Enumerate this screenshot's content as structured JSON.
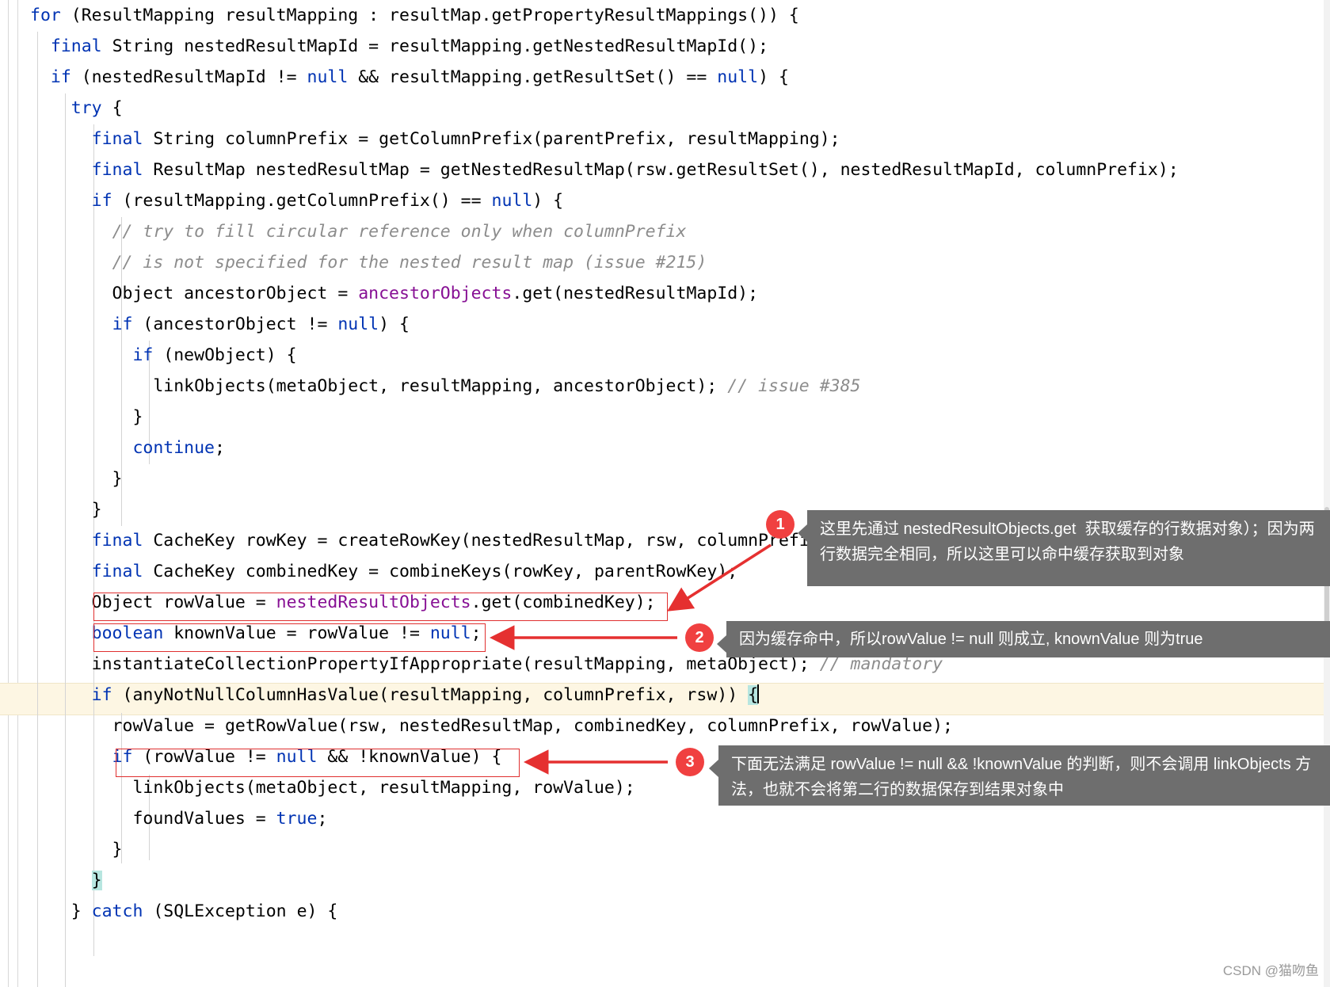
{
  "editor": {
    "language": "java",
    "lines": [
      [
        {
          "t": "kw",
          "s": "for"
        },
        {
          "t": "pln",
          "s": " (ResultMapping resultMapping : resultMap.getPropertyResultMappings()) {"
        }
      ],
      [
        {
          "t": "pln",
          "s": "  "
        },
        {
          "t": "kw",
          "s": "final"
        },
        {
          "t": "pln",
          "s": " String nestedResultMapId = resultMapping.getNestedResultMapId();"
        }
      ],
      [
        {
          "t": "pln",
          "s": "  "
        },
        {
          "t": "kw",
          "s": "if"
        },
        {
          "t": "pln",
          "s": " (nestedResultMapId != "
        },
        {
          "t": "kw",
          "s": "null"
        },
        {
          "t": "pln",
          "s": " && resultMapping.getResultSet() == "
        },
        {
          "t": "kw",
          "s": "null"
        },
        {
          "t": "pln",
          "s": ") {"
        }
      ],
      [
        {
          "t": "pln",
          "s": "    "
        },
        {
          "t": "kw",
          "s": "try"
        },
        {
          "t": "pln",
          "s": " {"
        }
      ],
      [
        {
          "t": "pln",
          "s": "      "
        },
        {
          "t": "kw",
          "s": "final"
        },
        {
          "t": "pln",
          "s": " String columnPrefix = getColumnPrefix(parentPrefix, resultMapping);"
        }
      ],
      [
        {
          "t": "pln",
          "s": "      "
        },
        {
          "t": "kw",
          "s": "final"
        },
        {
          "t": "pln",
          "s": " ResultMap nestedResultMap = getNestedResultMap(rsw.getResultSet(), nestedResultMapId, columnPrefix);"
        }
      ],
      [
        {
          "t": "pln",
          "s": "      "
        },
        {
          "t": "kw",
          "s": "if"
        },
        {
          "t": "pln",
          "s": " (resultMapping.getColumnPrefix() == "
        },
        {
          "t": "kw",
          "s": "null"
        },
        {
          "t": "pln",
          "s": ") {"
        }
      ],
      [
        {
          "t": "pln",
          "s": "        "
        },
        {
          "t": "cmt",
          "s": "// try to fill circular reference only when columnPrefix"
        }
      ],
      [
        {
          "t": "pln",
          "s": "        "
        },
        {
          "t": "cmt",
          "s": "// is not specified for the nested result map (issue #215)"
        }
      ],
      [
        {
          "t": "pln",
          "s": "        Object ancestorObject = "
        },
        {
          "t": "fld",
          "s": "ancestorObjects"
        },
        {
          "t": "pln",
          "s": ".get(nestedResultMapId);"
        }
      ],
      [
        {
          "t": "pln",
          "s": "        "
        },
        {
          "t": "kw",
          "s": "if"
        },
        {
          "t": "pln",
          "s": " (ancestorObject != "
        },
        {
          "t": "kw",
          "s": "null"
        },
        {
          "t": "pln",
          "s": ") {"
        }
      ],
      [
        {
          "t": "pln",
          "s": "          "
        },
        {
          "t": "kw",
          "s": "if"
        },
        {
          "t": "pln",
          "s": " (newObject) {"
        }
      ],
      [
        {
          "t": "pln",
          "s": "            linkObjects(metaObject, resultMapping, ancestorObject); "
        },
        {
          "t": "cmt",
          "s": "// issue #385"
        }
      ],
      [
        {
          "t": "pln",
          "s": "          }"
        }
      ],
      [
        {
          "t": "pln",
          "s": "          "
        },
        {
          "t": "kw",
          "s": "continue"
        },
        {
          "t": "pln",
          "s": ";"
        }
      ],
      [
        {
          "t": "pln",
          "s": "        }"
        }
      ],
      [
        {
          "t": "pln",
          "s": "      }"
        }
      ],
      [
        {
          "t": "pln",
          "s": "      "
        },
        {
          "t": "kw",
          "s": "final"
        },
        {
          "t": "pln",
          "s": " CacheKey rowKey = createRowKey(nestedResultMap, rsw, columnPrefix);"
        }
      ],
      [
        {
          "t": "pln",
          "s": "      "
        },
        {
          "t": "kw",
          "s": "final"
        },
        {
          "t": "pln",
          "s": " CacheKey combinedKey = combineKeys(rowKey, parentRowKey);"
        }
      ],
      [
        {
          "t": "pln",
          "s": "      Object rowValue = "
        },
        {
          "t": "fld",
          "s": "nestedResultObjects"
        },
        {
          "t": "pln",
          "s": ".get(combinedKey);"
        }
      ],
      [
        {
          "t": "pln",
          "s": "      "
        },
        {
          "t": "kw",
          "s": "boolean"
        },
        {
          "t": "pln",
          "s": " knownValue = rowValue != "
        },
        {
          "t": "kw",
          "s": "null"
        },
        {
          "t": "pln",
          "s": ";"
        }
      ],
      [
        {
          "t": "pln",
          "s": "      instantiateCollectionPropertyIfAppropriate(resultMapping, metaObject); "
        },
        {
          "t": "cmt",
          "s": "// mandatory"
        }
      ],
      [
        {
          "t": "pln",
          "s": "      "
        },
        {
          "t": "kw",
          "s": "if"
        },
        {
          "t": "pln",
          "s": " (anyNotNullColumnHasValue(resultMapping, columnPrefix, rsw)) "
        },
        {
          "t": "hl",
          "s": "{"
        }
      ],
      [
        {
          "t": "pln",
          "s": "        rowValue = getRowValue(rsw, nestedResultMap, combinedKey, columnPrefix, rowValue);"
        }
      ],
      [
        {
          "t": "pln",
          "s": "        "
        },
        {
          "t": "kw",
          "s": "if"
        },
        {
          "t": "pln",
          "s": " (rowValue != "
        },
        {
          "t": "kw",
          "s": "null"
        },
        {
          "t": "pln",
          "s": " && !knownValue) {"
        }
      ],
      [
        {
          "t": "pln",
          "s": "          linkObjects(metaObject, resultMapping, rowValue);"
        }
      ],
      [
        {
          "t": "pln",
          "s": "          foundValues = "
        },
        {
          "t": "kw",
          "s": "true"
        },
        {
          "t": "pln",
          "s": ";"
        }
      ],
      [
        {
          "t": "pln",
          "s": "        }"
        }
      ],
      [
        {
          "t": "pln",
          "s": "      "
        },
        {
          "t": "hl",
          "s": "}"
        }
      ],
      [
        {
          "t": "pln",
          "s": "    } "
        },
        {
          "t": "kw",
          "s": "catch"
        },
        {
          "t": "pln",
          "s": " (SQLException e) {"
        }
      ]
    ]
  },
  "annotations": [
    {
      "number": "1",
      "text": "这里先通过 nestedResultObjects.get  获取缓存的行数据对象）；因为两行数据完全相同，所以这里可以命中缓存获取到对象"
    },
    {
      "number": "2",
      "text": "因为缓存命中，所以rowValue != null 则成立, knownValue 则为true"
    },
    {
      "number": "3",
      "text": "下面无法满足 rowValue != null && !knownValue 的判断，则不会调用 linkObjects 方法，也就不会将第二行的数据保存到结果对象中"
    }
  ],
  "watermark": "CSDN @猫吻鱼",
  "colors": {
    "badge": "#f04040",
    "callout_bg": "#6e6e6e",
    "redbox": "#e03030",
    "keyword": "#0033b3",
    "comment": "#8c8c8c",
    "field": "#871094",
    "highlight_line": "#fdf6e3",
    "brace_match": "#b7e6e0"
  }
}
